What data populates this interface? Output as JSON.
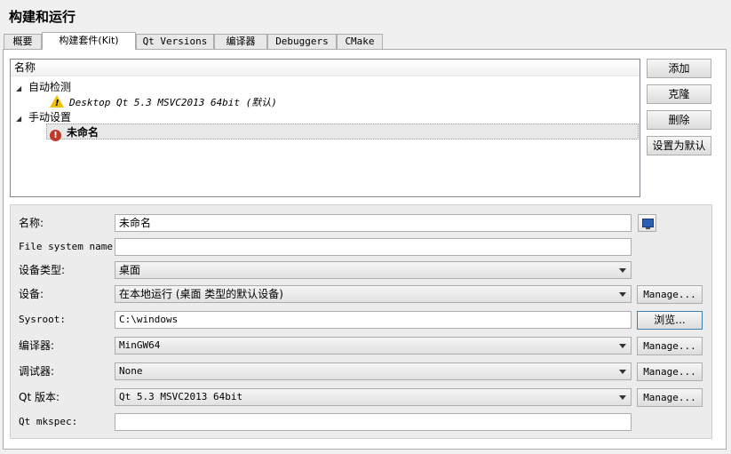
{
  "page_title": "构建和运行",
  "tabs": [
    {
      "label": "概要",
      "active": false
    },
    {
      "label": "构建套件(Kit)",
      "active": true
    },
    {
      "label": "Qt Versions",
      "active": false
    },
    {
      "label": "编译器",
      "active": false
    },
    {
      "label": "Debuggers",
      "active": false
    },
    {
      "label": "CMake",
      "active": false
    }
  ],
  "kit_tree": {
    "header": "名称",
    "groups": [
      {
        "label": "自动检测",
        "items": [
          {
            "label": "Desktop Qt 5.3 MSVC2013 64bit (默认)",
            "icon": "warning-icon"
          }
        ]
      },
      {
        "label": "手动设置",
        "items": [
          {
            "label": "未命名",
            "icon": "error-icon",
            "selected": true
          }
        ]
      }
    ]
  },
  "side_buttons": {
    "add": "添加",
    "clone": "克隆",
    "delete": "删除",
    "set_default": "设置为默认"
  },
  "form": {
    "name": {
      "label": "名称:",
      "value": "未命名"
    },
    "fs_name": {
      "label": "File system name:",
      "value": ""
    },
    "device_type": {
      "label": "设备类型:",
      "value": "桌面"
    },
    "device": {
      "label": "设备:",
      "value": "在本地运行 (桌面 类型的默认设备)",
      "button": "Manage..."
    },
    "sysroot": {
      "label": "Sysroot:",
      "value": "C:\\windows",
      "button": "浏览..."
    },
    "compiler": {
      "label": "编译器:",
      "value": "MinGW64",
      "button": "Manage..."
    },
    "debugger": {
      "label": "调试器:",
      "value": "None",
      "button": "Manage..."
    },
    "qt_version": {
      "label": "Qt 版本:",
      "value": "Qt 5.3 MSVC2013 64bit",
      "button": "Manage..."
    },
    "mkspec": {
      "label": "Qt mkspec:",
      "value": ""
    }
  },
  "icons": {
    "name_icon": "monitor-icon"
  },
  "colors": {
    "warning": "#f0c000",
    "error": "#c0392b",
    "focus": "#3c7fb1"
  }
}
